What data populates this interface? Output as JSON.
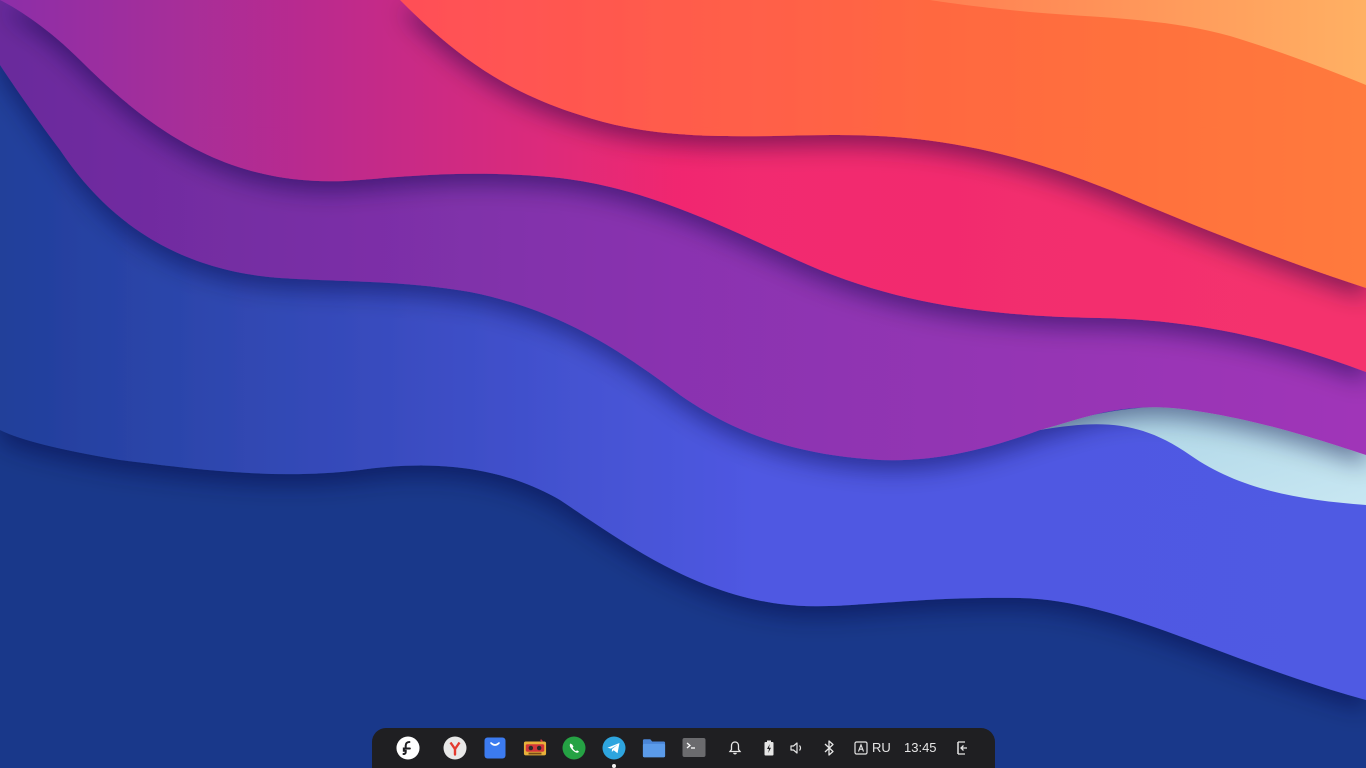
{
  "wallpaper": {
    "name": "desktop-wallpaper",
    "colors": {
      "deep_blue": "#19388a",
      "indigo": "#4f58e2",
      "violet": "#8a33b0",
      "pink": "#f1286f",
      "red": "#ff4f57",
      "orange": "#ff6a3f",
      "peach": "#ffb063",
      "ice": "#c4e3f0"
    }
  },
  "dock": {
    "apps": [
      {
        "id": "fedora-launcher",
        "icon": "fedora-icon",
        "interactable": true
      },
      {
        "id": "yandex-browser",
        "icon": "yandex-browser-icon",
        "interactable": true
      },
      {
        "id": "software-store",
        "icon": "shopping-bag-icon",
        "interactable": true
      },
      {
        "id": "media-app",
        "icon": "cassette-icon",
        "interactable": true
      },
      {
        "id": "whatsapp",
        "icon": "whatsapp-icon",
        "interactable": true
      },
      {
        "id": "telegram",
        "icon": "telegram-icon",
        "interactable": true,
        "running": true
      },
      {
        "id": "files",
        "icon": "folder-icon",
        "interactable": true
      },
      {
        "id": "terminal",
        "icon": "terminal-icon",
        "interactable": true
      }
    ],
    "tray": {
      "notifications_icon": "bell-icon",
      "battery_icon": "battery-charging-icon",
      "volume_icon": "speaker-icon",
      "bluetooth_icon": "bluetooth-icon",
      "keyboard_icon": "keyboard-layout-icon",
      "keyboard_layout": "RU",
      "clock": "13:45",
      "logout_icon": "logout-icon"
    }
  }
}
